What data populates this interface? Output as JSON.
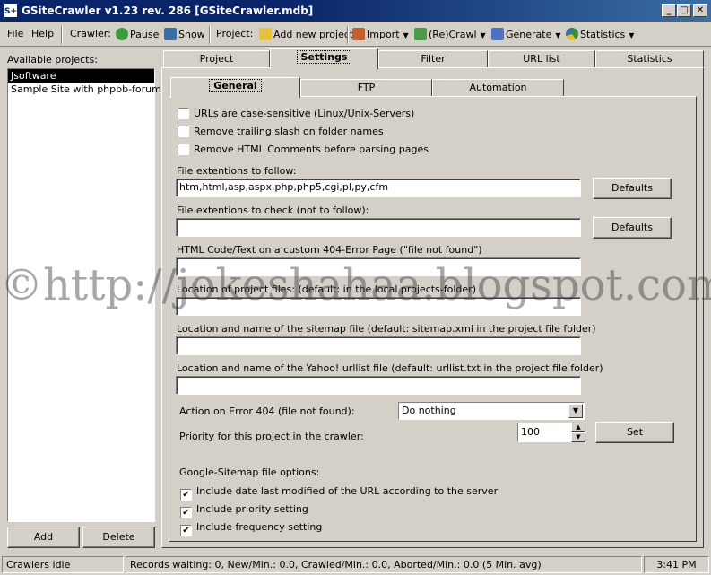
{
  "window": {
    "title": "GSiteCrawler v1.23 rev. 286 [GSiteCrawler.mdb]",
    "app_icon_text": "S+",
    "min_glyph": "_",
    "max_glyph": "□",
    "close_glyph": "✕"
  },
  "toolbar": {
    "file": "File",
    "help": "Help",
    "crawler_label": "Crawler:",
    "pause": "Pause",
    "show": "Show",
    "project_label": "Project:",
    "add_new_project": "Add new project",
    "import": "Import",
    "recrawl": "(Re)Crawl",
    "generate": "Generate",
    "statistics": "Statistics"
  },
  "left": {
    "available_label": "Available projects:",
    "projects": [
      "Jsoftware",
      "Sample Site with phpbb-forum"
    ],
    "add_button": "Add",
    "delete_button": "Delete"
  },
  "main_tabs": [
    "Project",
    "Settings",
    "Filter",
    "URL list",
    "Statistics"
  ],
  "sub_tabs": [
    "General",
    "FTP",
    "Automation"
  ],
  "general": {
    "cb_case": "URLs are case-sensitive (Linux/Unix-Servers)",
    "cb_trailing": "Remove trailing slash on folder names",
    "cb_html_comments": "Remove HTML Comments before parsing pages",
    "ext_follow_label": "File extentions to follow:",
    "ext_follow_value": "htm,html,asp,aspx,php,php5,cgi,pl,py,cfm",
    "defaults_button": "Defaults",
    "ext_check_label": "File extentions to check (not to follow):",
    "ext_check_value": "",
    "html404_label": "HTML Code/Text on a custom 404-Error Page (\"file not found\")",
    "location_label": "Location of project files: (default: in the local projects-folder)",
    "sitemap_label": "Location and name of the sitemap file (default: sitemap.xml in the project file folder)",
    "yahoo_label": "Location and name of the Yahoo! urllist file (default: urllist.txt in the project file folder)",
    "action404_label": "Action on Error 404 (file not found):",
    "action404_value": "Do nothing",
    "priority_label": "Priority for this project in the crawler:",
    "priority_value": "100",
    "set_button": "Set",
    "google_label": "Google-Sitemap file options:",
    "opt_date": "Include date last modified of the URL according to the server",
    "opt_priority": "Include priority setting",
    "opt_frequency": "Include frequency setting",
    "checked_glyph": "✔"
  },
  "status": {
    "left": "Crawlers idle",
    "middle": "Records waiting: 0, New/Min.: 0.0, Crawled/Min.: 0.0, Aborted/Min.: 0.0 (5 Min. avg)",
    "time": "3:41 PM"
  },
  "watermark": "©http://jokeshahaa.blogspot.com/",
  "colors": {
    "titlebar": "#0a246a",
    "face": "#d4d0c8",
    "selection": "#000000"
  }
}
